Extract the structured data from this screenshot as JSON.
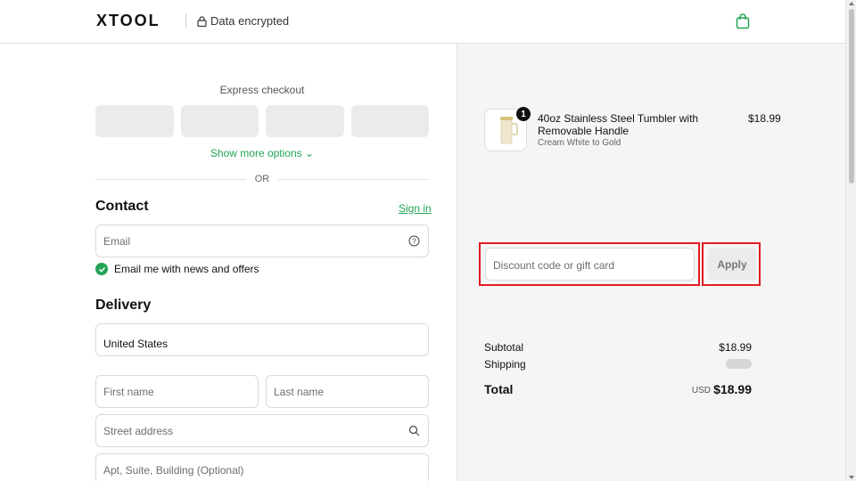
{
  "header": {
    "brand": "XTOOL",
    "encrypted_label": "Data encrypted",
    "brand_color": "#23a455",
    "icons": {
      "lock": "lock-icon",
      "cart": "shopping-bag-icon"
    }
  },
  "express": {
    "label": "Express checkout",
    "buttons": [
      "",
      "",
      "",
      ""
    ],
    "more_options": "Show more options",
    "or": "OR"
  },
  "contact": {
    "title": "Contact",
    "sign_in": "Sign in",
    "email_placeholder": "Email",
    "newsletter_label": "Email me with news and offers",
    "newsletter_checked": true
  },
  "delivery": {
    "title": "Delivery",
    "country": "United States",
    "first_name_placeholder": "First name",
    "last_name_placeholder": "Last name",
    "street_placeholder": "Street address",
    "apt_placeholder": "Apt, Suite, Building (Optional)"
  },
  "order": {
    "item": {
      "quantity": "1",
      "name": "40oz Stainless Steel Tumbler with Removable Handle",
      "variant": "Cream White to Gold",
      "price": "$18.99"
    },
    "discount_placeholder": "Discount code or gift card",
    "apply_label": "Apply",
    "subtotal_label": "Subtotal",
    "subtotal_value": "$18.99",
    "shipping_label": "Shipping",
    "total_label": "Total",
    "currency": "USD",
    "total_value": "$18.99"
  },
  "colors": {
    "accent": "#23a455",
    "highlight": "#e31b23"
  }
}
